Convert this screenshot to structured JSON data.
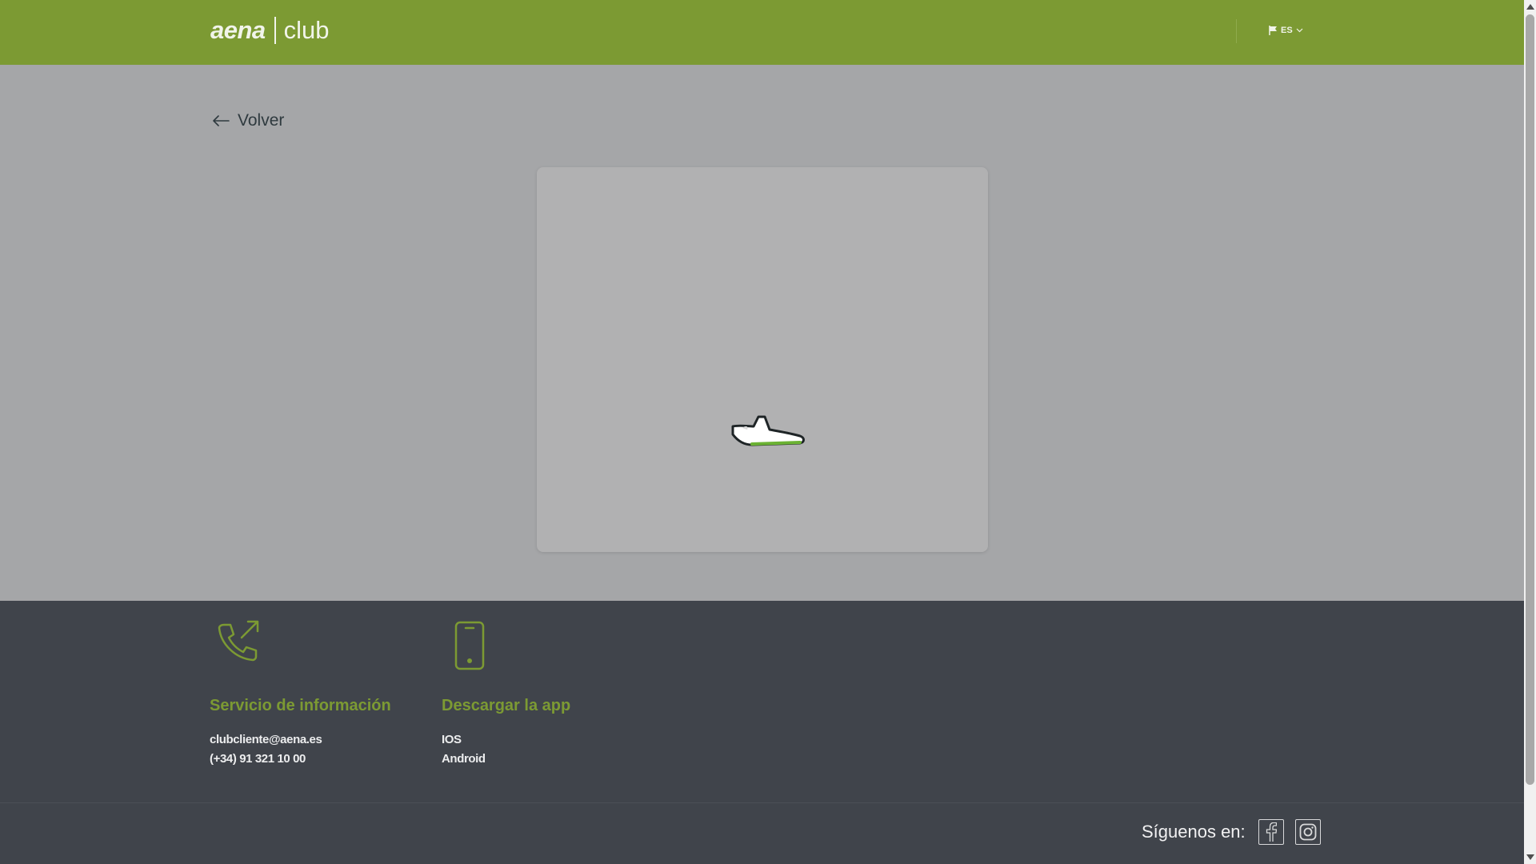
{
  "header": {
    "brand": "aena",
    "brand_suffix": "club",
    "language": "ES",
    "background_color": "#7c9a33"
  },
  "nav": {
    "back_label": "Volver"
  },
  "loader": {
    "icon": "airplane-icon"
  },
  "footer": {
    "info": {
      "icon": "phone-outgoing-icon",
      "title": "Servicio de información",
      "email": "clubcliente@aena.es",
      "phone": "(+34) 91 321 10 00"
    },
    "app": {
      "icon": "smartphone-icon",
      "title": "Descargar la app",
      "ios": "IOS",
      "android": "Android"
    },
    "social": {
      "label": "Síguenos en:",
      "networks": [
        "facebook-icon",
        "instagram-icon"
      ]
    },
    "accent_color": "#7c9a33",
    "background_color": "#40444b"
  }
}
